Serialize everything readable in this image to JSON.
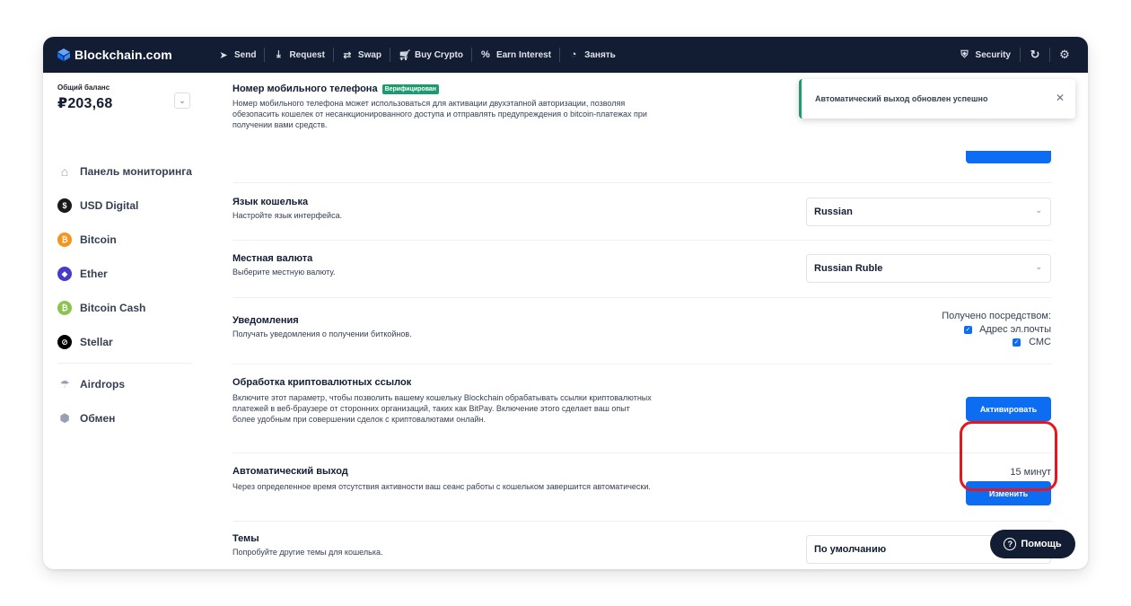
{
  "app": {
    "brand": "Blockchain.com"
  },
  "nav": {
    "items": [
      {
        "label": "Send",
        "icon": "send-icon"
      },
      {
        "label": "Request",
        "icon": "download-icon"
      },
      {
        "label": "Swap",
        "icon": "swap-icon"
      },
      {
        "label": "Buy Crypto",
        "icon": "cart-icon"
      },
      {
        "label": "Earn Interest",
        "icon": "percent-icon"
      },
      {
        "label": "Занять",
        "icon": "pie-icon"
      }
    ],
    "security": "Security"
  },
  "sidebar": {
    "balance_label": "Общий баланс",
    "balance_value": "₽203,68",
    "items": [
      {
        "label": "Панель мониторинга",
        "icon": "home-icon"
      },
      {
        "label": "USD Digital",
        "icon": "usd-icon",
        "color": "#1a1a1a"
      },
      {
        "label": "Bitcoin",
        "icon": "bitcoin-icon",
        "color": "#f7931a"
      },
      {
        "label": "Ether",
        "icon": "ether-icon",
        "color": "#473bcb"
      },
      {
        "label": "Bitcoin Cash",
        "icon": "bitcoin-cash-icon",
        "color": "#8dc351"
      },
      {
        "label": "Stellar",
        "icon": "stellar-icon",
        "color": "#000000"
      }
    ],
    "extra": [
      {
        "label": "Airdrops",
        "icon": "parachute-icon"
      },
      {
        "label": "Обмен",
        "icon": "exchange-icon"
      }
    ]
  },
  "settings": {
    "phone": {
      "title": "Номер мобильного телефона",
      "badge": "Верифицирован",
      "desc": "Номер мобильного телефона может использоваться для активации двухэтапной авторизации, позволяя обезопасить кошелек от несанкционированного доступа и отправлять предупреждения о bitcoin-платежах при получении вами средств."
    },
    "language": {
      "title": "Язык кошелька",
      "desc": "Настройте язык интерфейса.",
      "value": "Russian"
    },
    "currency": {
      "title": "Местная валюта",
      "desc": "Выберите местную валюту.",
      "value": "Russian Ruble"
    },
    "notifications": {
      "title": "Уведомления",
      "desc": "Получать уведомления о получении биткойнов.",
      "via_label": "Получено посредством:",
      "email": "Адрес эл.почты",
      "sms": "СМС"
    },
    "links": {
      "title": "Обработка криптовалютных ссылок",
      "desc": "Включите этот параметр, чтобы позволить вашему кошельку Blockchain обрабатывать ссылки криптовалютных платежей в веб-браузере от сторонних организаций, таких как BitPay. Включение этого сделает ваш опыт более удобным при совершении сделок с криптовалютами онлайн.",
      "button": "Активировать"
    },
    "autologout": {
      "title": "Автоматический выход",
      "desc": "Через определенное время отсутствия активности ваш сеанс работы с кошельком завершится автоматически.",
      "value": "15 минут",
      "button": "Изменить"
    },
    "themes": {
      "title": "Темы",
      "desc": "Попробуйте другие темы для кошелька.",
      "value": "По умолчанию"
    }
  },
  "toast": {
    "message": "Автоматический выход обновлен успешно"
  },
  "help": {
    "label": "Помощь"
  }
}
